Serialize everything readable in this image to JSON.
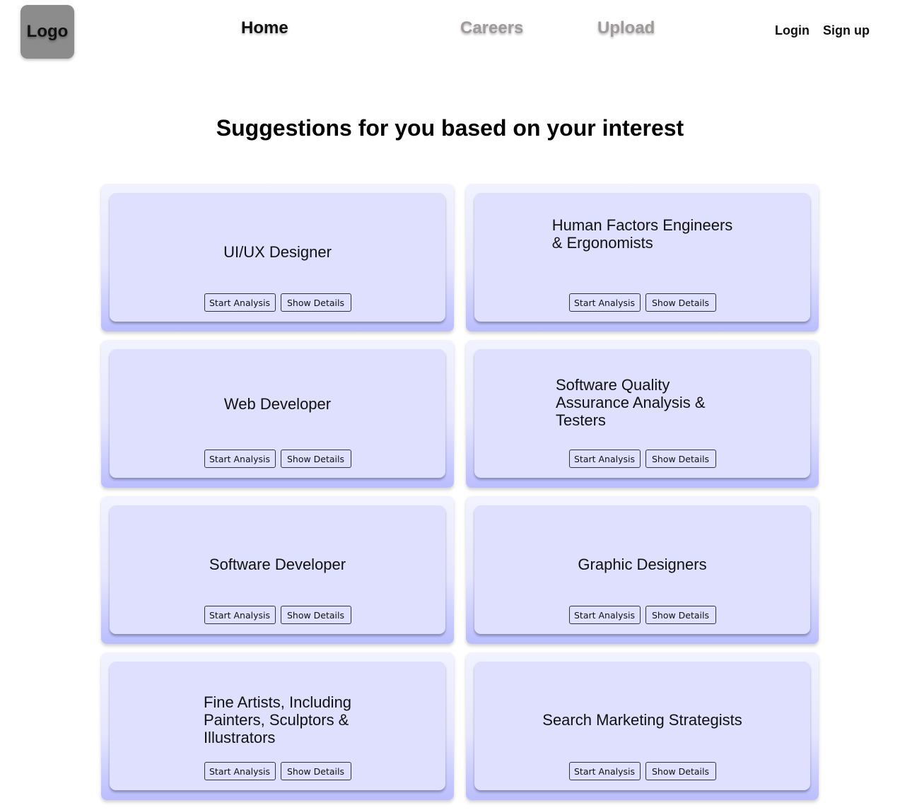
{
  "header": {
    "logo": "Logo",
    "nav": {
      "home": "Home",
      "careers": "Careers",
      "upload": "Upload"
    },
    "auth": {
      "login": "Login",
      "signup": "Sign up"
    }
  },
  "main": {
    "title": "Suggestions for you based on your interest",
    "cards": [
      {
        "title": "UI/UX Designer",
        "start_label": "Start Analysis",
        "details_label": "Show Details"
      },
      {
        "title": "Human Factors Engineers\n& Ergonomists",
        "start_label": "Start Analysis",
        "details_label": "Show Details"
      },
      {
        "title": "Web Developer",
        "start_label": "Start Analysis",
        "details_label": "Show Details"
      },
      {
        "title": "Software Quality\nAssurance Analysis &\nTesters",
        "start_label": "Start Analysis",
        "details_label": "Show Details"
      },
      {
        "title": "Software Developer",
        "start_label": "Start Analysis",
        "details_label": "Show Details"
      },
      {
        "title": "Graphic Designers",
        "start_label": "Start Analysis",
        "details_label": "Show Details"
      },
      {
        "title": "Fine Artists, Including\nPainters, Sculptors &\nIllustrators",
        "start_label": "Start Analysis",
        "details_label": "Show Details"
      },
      {
        "title": "Search Marketing Strategists",
        "start_label": "Start Analysis",
        "details_label": "Show Details"
      }
    ]
  },
  "colors": {
    "card_fill": "#dfe0fd",
    "card_gradient_bottom": "#babdff",
    "logo_bg": "#8c8c8c",
    "inactive_nav": "#a19a9a"
  }
}
